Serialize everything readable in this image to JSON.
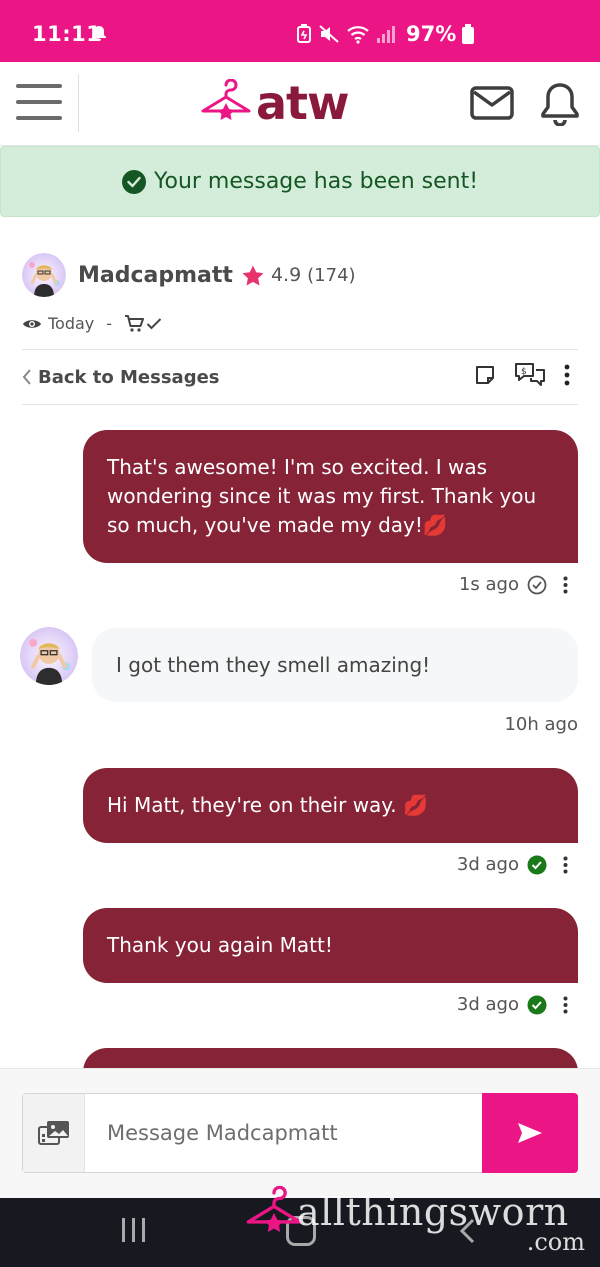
{
  "status_bar": {
    "time": "11:11",
    "battery": "97%"
  },
  "header": {
    "logo_text": "atw",
    "brand_color": "#8a1a3c",
    "accent_color": "#ec1585"
  },
  "alert": {
    "text": "Your message has been sent!"
  },
  "conversation": {
    "username": "Madcapmatt",
    "rating": "4.9",
    "rating_count": "(174)",
    "seen": "Today",
    "separator": "-"
  },
  "toolbar": {
    "back_label": "Back to Messages"
  },
  "messages": [
    {
      "direction": "outgoing",
      "text": "That's awesome! I'm so excited. I was wondering since it was my first. Thank you so much, you've made my day!💋",
      "time": "1s ago",
      "status": "sent"
    },
    {
      "direction": "incoming",
      "text": "I got them they smell amazing!",
      "time": "10h ago"
    },
    {
      "direction": "outgoing",
      "text": "Hi Matt, they're on their way. 💋",
      "time": "3d ago",
      "status": "read"
    },
    {
      "direction": "outgoing",
      "text": "Thank you again Matt!",
      "time": "3d ago",
      "status": "read"
    }
  ],
  "composer": {
    "placeholder": "Message Madcapmatt"
  },
  "watermark": {
    "text": "allthingsworn",
    "suffix": ".com"
  }
}
